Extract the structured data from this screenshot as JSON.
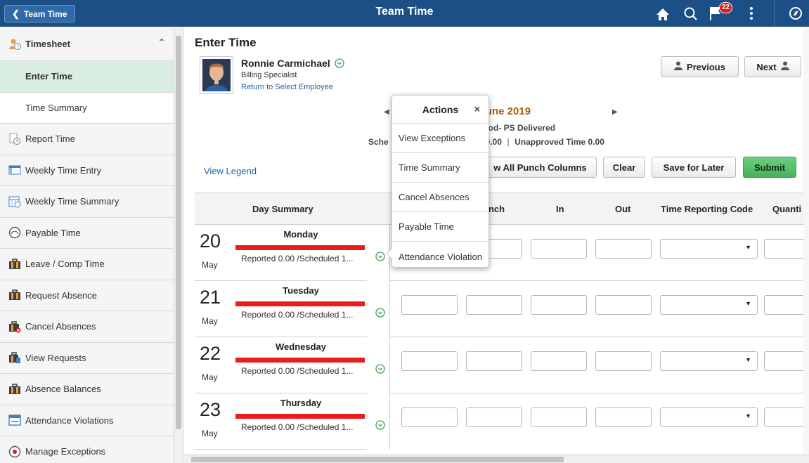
{
  "header": {
    "back_label": "Team Time",
    "title": "Team Time",
    "notification_count": "22",
    "icons": [
      "home-icon",
      "search-icon",
      "notification-flag-icon",
      "more-actions-icon",
      "navbar-compass-icon"
    ]
  },
  "sidebar": {
    "section_label": "Timesheet",
    "items": [
      {
        "label": "Enter Time",
        "icon": "none"
      },
      {
        "label": "Time Summary",
        "icon": "none"
      },
      {
        "label": "Report Time",
        "icon": "report-time-icon"
      },
      {
        "label": "Weekly Time Entry",
        "icon": "weekly-time-entry-icon"
      },
      {
        "label": "Weekly Time Summary",
        "icon": "weekly-time-summary-icon"
      },
      {
        "label": "Payable Time",
        "icon": "payable-time-icon"
      },
      {
        "label": "Leave / Comp Time",
        "icon": "briefcase-icon"
      },
      {
        "label": "Request Absence",
        "icon": "briefcase-icon"
      },
      {
        "label": "Cancel Absences",
        "icon": "briefcase-cancel-icon"
      },
      {
        "label": "View Requests",
        "icon": "briefcase-view-icon"
      },
      {
        "label": "Absence Balances",
        "icon": "briefcase-icon"
      },
      {
        "label": "Attendance Violations",
        "icon": "calendar-icon"
      },
      {
        "label": "Manage Exceptions",
        "icon": "exceptions-icon"
      }
    ]
  },
  "main": {
    "page_title": "Enter Time",
    "employee": {
      "name": "Ronnie Carmichael",
      "title": "Billing Specialist",
      "return_link": "Return to Select Employee"
    },
    "buttons": {
      "previous": "Previous",
      "next": "Next",
      "show_all_punch": "w All Punch Columns",
      "clear": "Clear",
      "save_for_later": "Save for Later",
      "submit": "Submit"
    },
    "period_label": "2 June 2019",
    "schedule_line1": "eriod- PS Delivered",
    "schedule_label": "Sche",
    "schedule_line2_a": "d  0.00",
    "schedule_line2_b": "Unapproved Time  0.00",
    "view_legend": "View Legend",
    "columns": {
      "day_summary": "Day Summary",
      "punch": "unch",
      "in": "In",
      "out": "Out",
      "trc": "Time Reporting Code",
      "quantity": "Quanti"
    },
    "days": [
      {
        "num": "20",
        "month": "May",
        "name": "Monday",
        "reported": "Reported 0.00 /Scheduled 1..."
      },
      {
        "num": "21",
        "month": "May",
        "name": "Tuesday",
        "reported": "Reported 0.00 /Scheduled 1..."
      },
      {
        "num": "22",
        "month": "May",
        "name": "Wednesday",
        "reported": "Reported 0.00 /Scheduled 1..."
      },
      {
        "num": "23",
        "month": "May",
        "name": "Thursday",
        "reported": "Reported 0.00 /Scheduled 1..."
      }
    ]
  },
  "popup": {
    "title": "Actions",
    "close": "×",
    "items": [
      "View Exceptions",
      "Time Summary",
      "Cancel Absences",
      "Payable Time",
      "Attendance Violation"
    ]
  },
  "colors": {
    "header_bg": "#1c4f86",
    "active_item_bg": "#d9eee0",
    "submit_green": "#45b25a",
    "period_orange": "#a95d12",
    "status_red": "#ed1c1c",
    "link_blue": "#1f5fa8"
  }
}
